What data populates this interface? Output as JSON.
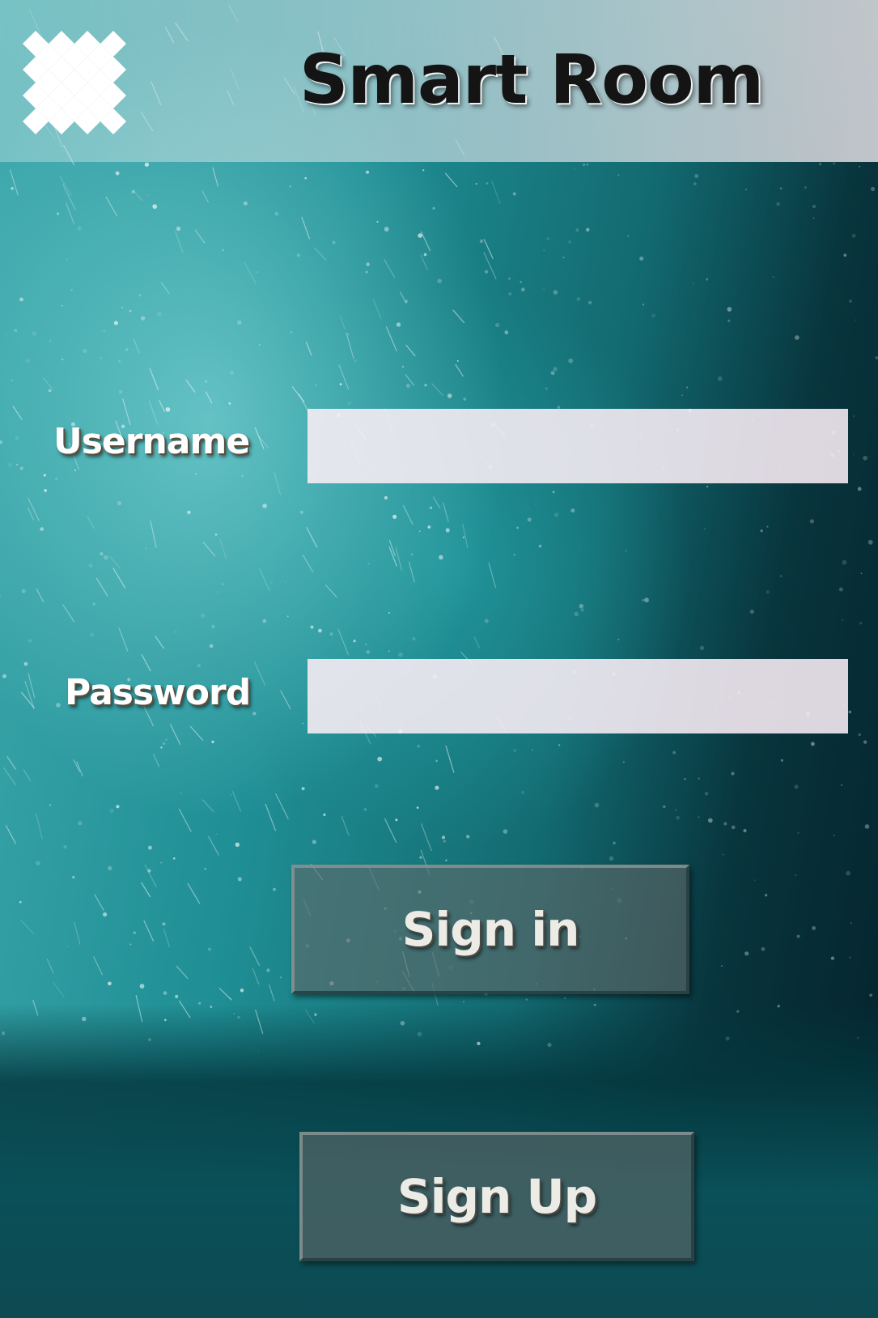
{
  "header": {
    "title": "Smart Room",
    "logo_icon": "checkerboard-logo-icon"
  },
  "form": {
    "username": {
      "label": "Username",
      "value": "",
      "placeholder": ""
    },
    "password": {
      "label": "Password",
      "value": "",
      "placeholder": ""
    }
  },
  "actions": {
    "sign_in_label": "Sign in",
    "sign_up_label": "Sign Up"
  },
  "colors": {
    "header_tint": "#e8eaee",
    "input_fill": "#faeef6",
    "button_fill": "#5f6969",
    "background_teal": "#1f8f95",
    "background_dark": "#04222b"
  }
}
